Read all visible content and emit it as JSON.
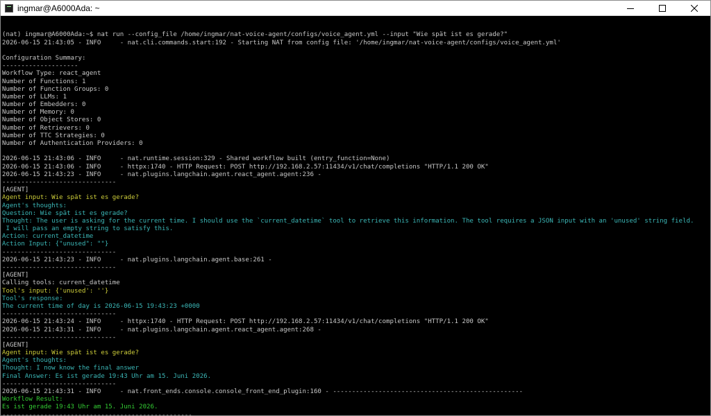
{
  "window": {
    "title": "ingmar@A6000Ada: ~"
  },
  "colors": {
    "default": "#c8c8c8",
    "yellow": "#cdcd3a",
    "cyan": "#3bb7b7",
    "green": "#33cc33",
    "cursor": "#22dd22"
  },
  "terminal": {
    "lines": [
      {
        "text": "(nat) ingmar@A6000Ada:~$ nat run --config_file /home/ingmar/nat-voice-agent/configs/voice_agent.yml --input \"Wie spät ist es gerade?\"",
        "color": "default"
      },
      {
        "text": "2026-06-15 21:43:05 - INFO     - nat.cli.commands.start:192 - Starting NAT from config file: '/home/ingmar/nat-voice-agent/configs/voice_agent.yml'",
        "color": "default"
      },
      {
        "text": "",
        "color": "default"
      },
      {
        "text": "Configuration Summary:",
        "color": "default"
      },
      {
        "text": "--------------------",
        "color": "default"
      },
      {
        "text": "Workflow Type: react_agent",
        "color": "default"
      },
      {
        "text": "Number of Functions: 1",
        "color": "default"
      },
      {
        "text": "Number of Function Groups: 0",
        "color": "default"
      },
      {
        "text": "Number of LLMs: 1",
        "color": "default"
      },
      {
        "text": "Number of Embedders: 0",
        "color": "default"
      },
      {
        "text": "Number of Memory: 0",
        "color": "default"
      },
      {
        "text": "Number of Object Stores: 0",
        "color": "default"
      },
      {
        "text": "Number of Retrievers: 0",
        "color": "default"
      },
      {
        "text": "Number of TTC Strategies: 0",
        "color": "default"
      },
      {
        "text": "Number of Authentication Providers: 0",
        "color": "default"
      },
      {
        "text": "",
        "color": "default"
      },
      {
        "text": "2026-06-15 21:43:06 - INFO     - nat.runtime.session:329 - Shared workflow built (entry_function=None)",
        "color": "default"
      },
      {
        "text": "2026-06-15 21:43:06 - INFO     - httpx:1740 - HTTP Request: POST http://192.168.2.57:11434/v1/chat/completions \"HTTP/1.1 200 OK\"",
        "color": "default"
      },
      {
        "text": "2026-06-15 21:43:23 - INFO     - nat.plugins.langchain.agent.react_agent.agent:236 -",
        "color": "default"
      },
      {
        "text": "------------------------------",
        "color": "default"
      },
      {
        "text": "[AGENT]",
        "color": "default"
      },
      {
        "text": "Agent input: Wie spät ist es gerade?",
        "color": "yellow"
      },
      {
        "text": "Agent's thoughts:",
        "color": "cyan"
      },
      {
        "text": "Question: Wie spät ist es gerade?",
        "color": "cyan"
      },
      {
        "text": "Thought: The user is asking for the current time. I should use the `current_datetime` tool to retrieve this information. The tool requires a JSON input with an 'unused' string field.",
        "color": "cyan"
      },
      {
        "text": " I will pass an empty string to satisfy this.",
        "color": "cyan"
      },
      {
        "text": "Action: current_datetime",
        "color": "cyan"
      },
      {
        "text": "Action Input: {\"unused\": \"\"}",
        "color": "cyan"
      },
      {
        "text": "------------------------------",
        "color": "default"
      },
      {
        "text": "2026-06-15 21:43:23 - INFO     - nat.plugins.langchain.agent.base:261 -",
        "color": "default"
      },
      {
        "text": "------------------------------",
        "color": "default"
      },
      {
        "text": "[AGENT]",
        "color": "default"
      },
      {
        "text": "Calling tools: current_datetime",
        "color": "default"
      },
      {
        "text": "Tool's input: {'unused': ''}",
        "color": "yellow"
      },
      {
        "text": "Tool's response:",
        "color": "cyan"
      },
      {
        "text": "The current time of day is 2026-06-15 19:43:23 +0000",
        "color": "cyan"
      },
      {
        "text": "------------------------------",
        "color": "default"
      },
      {
        "text": "2026-06-15 21:43:24 - INFO     - httpx:1740 - HTTP Request: POST http://192.168.2.57:11434/v1/chat/completions \"HTTP/1.1 200 OK\"",
        "color": "default"
      },
      {
        "text": "2026-06-15 21:43:31 - INFO     - nat.plugins.langchain.agent.react_agent.agent:268 -",
        "color": "default"
      },
      {
        "text": "------------------------------",
        "color": "default"
      },
      {
        "text": "[AGENT]",
        "color": "default"
      },
      {
        "text": "Agent input: Wie spät ist es gerade?",
        "color": "yellow"
      },
      {
        "text": "Agent's thoughts:",
        "color": "cyan"
      },
      {
        "text": "Thought: I now know the final answer",
        "color": "cyan"
      },
      {
        "text": "Final Answer: Es ist gerade 19:43 Uhr am 15. Juni 2026.",
        "color": "cyan"
      },
      {
        "text": "------------------------------",
        "color": "default"
      },
      {
        "text": "2026-06-15 21:43:31 - INFO     - nat.front_ends.console.console_front_end_plugin:160 - --------------------------------------------------",
        "color": "default"
      },
      {
        "text": "Workflow Result:",
        "color": "green"
      },
      {
        "text": "Es ist gerade 19:43 Uhr am 15. Juni 2026.",
        "color": "green"
      },
      {
        "text": "--------------------------------------------------",
        "color": "default"
      }
    ],
    "prompt": "(nat) ingmar@A6000Ada:~$ "
  }
}
